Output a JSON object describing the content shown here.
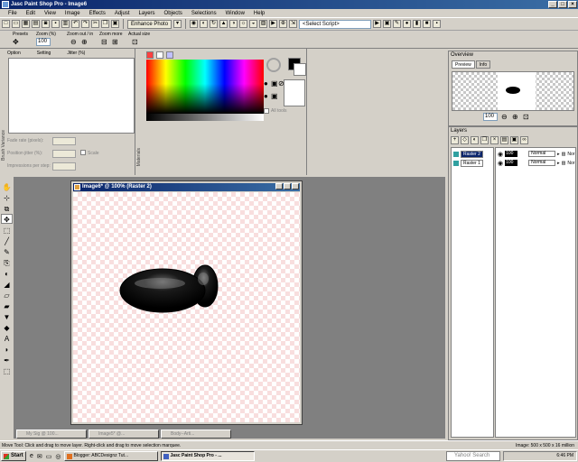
{
  "app": {
    "title": "Jasc Paint Shop Pro - Image6",
    "window_controls": [
      "_",
      "□",
      "×"
    ]
  },
  "menu": [
    "File",
    "Edit",
    "View",
    "Image",
    "Effects",
    "Adjust",
    "Layers",
    "Objects",
    "Selections",
    "Window",
    "Help"
  ],
  "toolbar": {
    "enhance_label": "Enhance Photo",
    "script_placeholder": "<Select Script>"
  },
  "tool_options": {
    "presets_label": "Presets",
    "zoom_pct_label": "Zoom (%)",
    "zoom_value": "100",
    "zoom_out_in_label": "Zoom out / in",
    "zoom_more_label": "Zoom more",
    "actual_size_label": "Actual size"
  },
  "brush_variance": {
    "tab_label": "Brush Variance",
    "columns": [
      "Option",
      "Setting",
      "Jitter (%)"
    ],
    "fields": [
      "Fade rate (pixels):",
      "Position jitter (%):",
      "Impressions per step:"
    ],
    "scale_label": "Scale"
  },
  "materials": {
    "tab_label": "Materials",
    "all_tools_label": "All tools"
  },
  "overview": {
    "title": "Overview",
    "tabs": [
      "Preview",
      "Info"
    ],
    "zoom_value": "100"
  },
  "layers": {
    "title": "Layers",
    "items": [
      {
        "name": "Raster 2",
        "opacity": "100",
        "blend": "Normal",
        "mode": "Nor",
        "active": true
      },
      {
        "name": "Raster 1",
        "opacity": "100",
        "blend": "Normal",
        "mode": "Nor",
        "active": false
      }
    ]
  },
  "image_window": {
    "title": "Image6* @ 100% (Raster 2)"
  },
  "minimized_windows": [
    "My Sig @ 100...",
    "Image5* @...",
    "Body--Arti..."
  ],
  "status": {
    "left": "Move Tool: Click and drag to move layer. Right-click and drag to move selection marquee.",
    "right": "Image:  500 x 500 x 16 million"
  },
  "taskbar": {
    "start": "Start",
    "tasks": [
      "Blogger: ABCDesignz Tut...",
      "Jasc Paint Shop Pro - ..."
    ],
    "search_placeholder": "Yahoo! Search",
    "clock": "6:46 PM"
  },
  "colors": {
    "title_gradient_start": "#0a246a",
    "title_gradient_end": "#3a6ea5",
    "workspace": "#808080",
    "chrome": "#d4d0c8"
  }
}
